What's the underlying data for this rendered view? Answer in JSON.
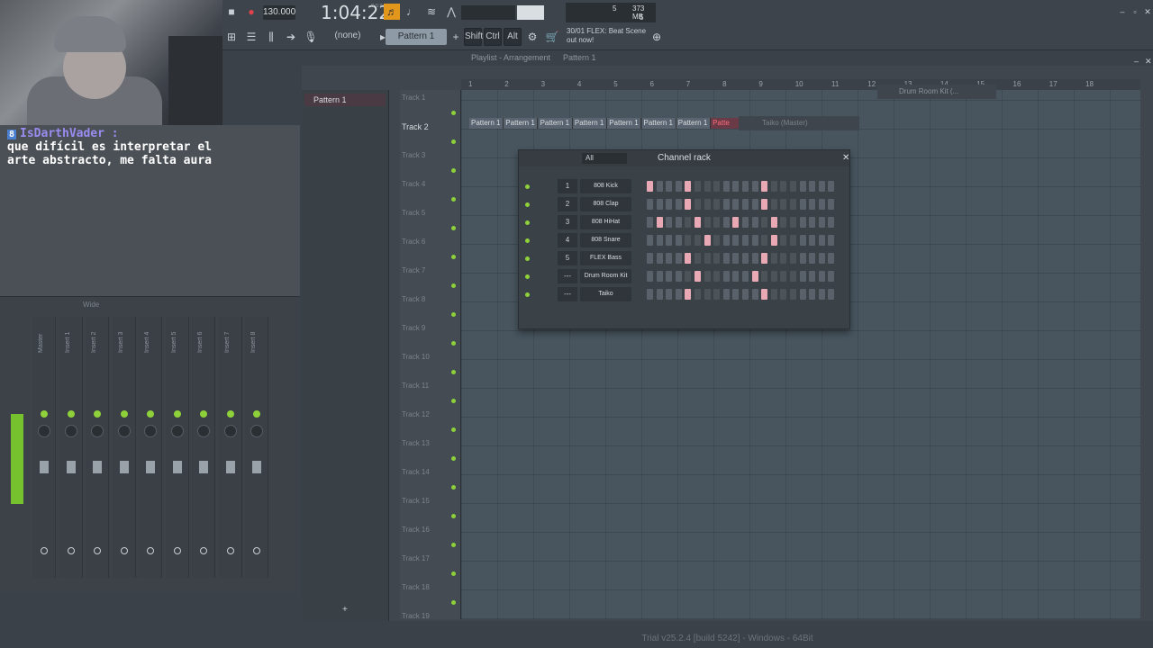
{
  "topbar": {
    "tempo": "130.000",
    "time": "1:04:22",
    "time_suffix": "B:S:T",
    "cpu": "5",
    "ram": "373 MB",
    "poly": "5",
    "snap": "(none)",
    "pattern": "Pattern 1",
    "shift": "Shift",
    "ctrl": "Ctrl",
    "alt": "Alt",
    "hint_line1": "30/01  FLEX: Beat Scene",
    "hint_line2": "out now!"
  },
  "chat": {
    "badge": "8",
    "username": "IsDarthVader :",
    "message": "que difícil es interpretar el arte abstracto, me falta aura"
  },
  "mixer": {
    "title": "Wide",
    "strips": [
      "Master",
      "Insert 1",
      "Insert 2",
      "Insert 3",
      "Insert 4",
      "Insert 5",
      "Insert 6",
      "Insert 7",
      "Insert 8"
    ]
  },
  "playlist": {
    "title": "Playlist - Arrangement",
    "breadcrumb": "Pattern 1",
    "pattern_item": "Pattern 1",
    "ruler": [
      "1",
      "2",
      "3",
      "4",
      "5",
      "6",
      "7",
      "8",
      "9",
      "10",
      "11",
      "12",
      "13",
      "14",
      "15",
      "16",
      "17",
      "18"
    ],
    "tracks": [
      "Track 1",
      "Track 2",
      "Track 3",
      "Track 4",
      "Track 5",
      "Track 6",
      "Track 7",
      "Track 8",
      "Track 9",
      "Track 10",
      "Track 11",
      "Track 12",
      "Track 13",
      "Track 14",
      "Track 15",
      "Track 16",
      "Track 17",
      "Track 18",
      "Track 19"
    ],
    "clips": [
      "Pattern 1",
      "Pattern 1",
      "Pattern 1",
      "Pattern 1",
      "Pattern 1",
      "Pattern 1",
      "Pattern 1",
      "Patte"
    ],
    "float_drum": "Drum Room Kit (...",
    "float_taiko": "Taiko (Master)"
  },
  "rack": {
    "title": "Channel rack",
    "filter": "All",
    "channels": [
      {
        "num": "1",
        "name": "808 Kick"
      },
      {
        "num": "2",
        "name": "808 Clap"
      },
      {
        "num": "3",
        "name": "808 HiHat"
      },
      {
        "num": "4",
        "name": "808 Snare"
      },
      {
        "num": "5",
        "name": "FLEX Bass"
      },
      {
        "num": "---",
        "name": "Drum Room Kit"
      },
      {
        "num": "---",
        "name": "Taiko"
      }
    ]
  },
  "status": "Trial v25.2.4 [build 5242] - Windows - 64Bit"
}
